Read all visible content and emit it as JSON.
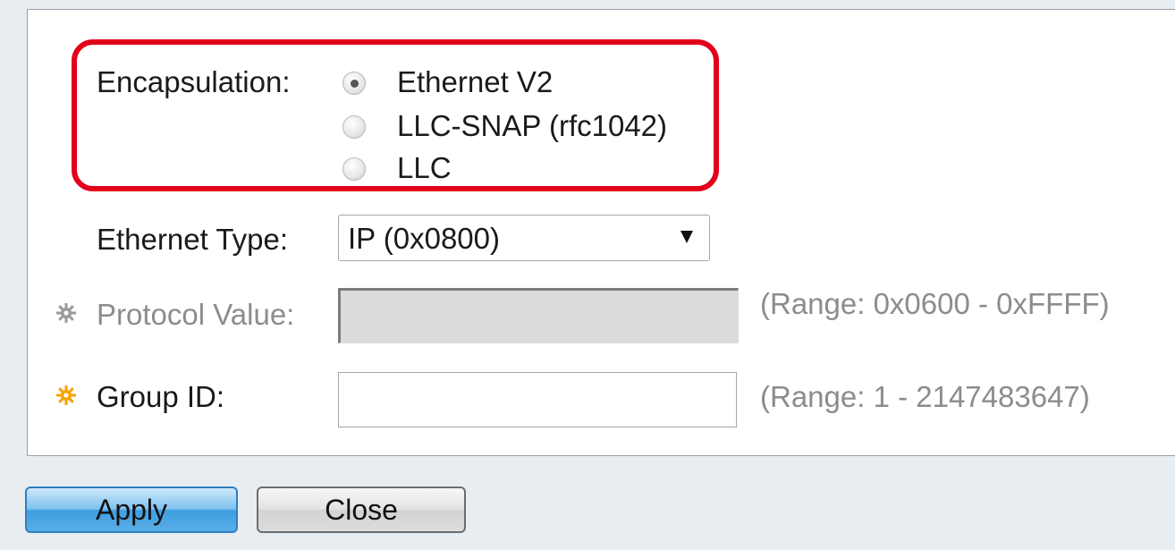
{
  "form": {
    "encapsulation": {
      "label": "Encapsulation:",
      "options": [
        {
          "label": "Ethernet V2",
          "selected": true
        },
        {
          "label": "LLC-SNAP (rfc1042)",
          "selected": false
        },
        {
          "label": "LLC",
          "selected": false
        }
      ]
    },
    "ethernet_type": {
      "label": "Ethernet Type:",
      "selected_value": "IP (0x0800)"
    },
    "protocol_value": {
      "label": "Protocol Value:",
      "value": "",
      "hint": "(Range: 0x0600 - 0xFFFF)",
      "disabled": true,
      "icon": "gear-icon"
    },
    "group_id": {
      "label": "Group ID:",
      "value": "",
      "hint": "(Range: 1 - 2147483647)",
      "required": true,
      "icon": "gear-icon"
    }
  },
  "buttons": {
    "apply_label": "Apply",
    "close_label": "Close"
  },
  "colors": {
    "highlight": "#e3001b",
    "required_icon": "#f5a300",
    "disabled_icon": "#9a9a9a",
    "apply_button": "#4aa6e6"
  }
}
